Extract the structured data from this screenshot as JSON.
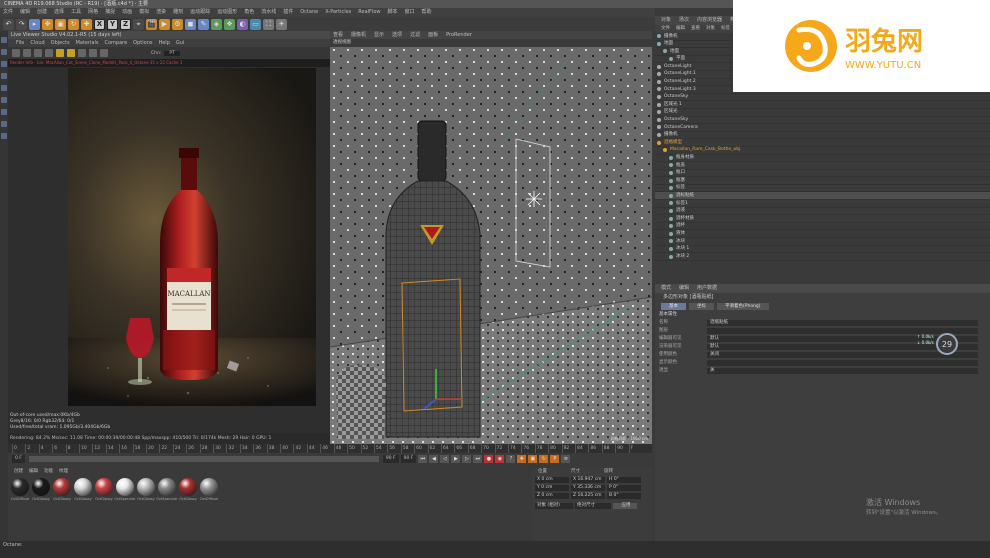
{
  "app": {
    "title": "CINEMA 4D R19.068 Studio (RC - R19) - [酒瓶.c4d *] - 主要",
    "menus": [
      "文件",
      "编辑",
      "创建",
      "选择",
      "工具",
      "网格",
      "捕捉",
      "动画",
      "模拟",
      "渲染",
      "雕刻",
      "运动跟踪",
      "运动图形",
      "角色",
      "流水线",
      "插件",
      "Octane",
      "X-Particles",
      "RealFlow",
      "脚本",
      "窗口",
      "帮助"
    ],
    "status_text": "Octane:"
  },
  "toolbar": {
    "axis_buttons": [
      "X",
      "Y",
      "Z"
    ]
  },
  "live_viewer": {
    "title": "Live Viewer Studio V4.02.1-R5 (15 days left)",
    "menus": [
      "File",
      "Cloud",
      "Objects",
      "Materials",
      "Compare",
      "Options",
      "Help",
      "Gui"
    ],
    "channel_label": "Chn:",
    "channel_value": "PT",
    "path_text": "Render Info - bin: MacAllan_Cut_Scene_Clone_Models_Pack_4_Octane 35 x 22 Cache 1",
    "stats": [
      "Out-of-core used/max:0Kb/4Gb",
      "Grey8/16: 0/0          Rgb32/64: 0/1",
      "Used/free/total vram: 1.095Gb/3.404Gb/6Gb"
    ],
    "status_line": "Rendering: 84.2%   Ms/sec: 11.08   Time: 00:00:39/00:00:48   Spp/maxspp: 410/500   Tri: 0/174k   Mesh: 29   Hair: 0   GPU: 1"
  },
  "viewport": {
    "menus": [
      "查看",
      "摄像机",
      "显示",
      "选项",
      "过滤",
      "面板",
      "ProRender"
    ],
    "label": "透视视图",
    "footer": "网格间距 : 1000 cm"
  },
  "object_manager": {
    "tabs": [
      "对象",
      "场次",
      "内容浏览器",
      "构造"
    ],
    "menus": [
      "文件",
      "编辑",
      "查看",
      "对象",
      "标签",
      "书签"
    ],
    "items": [
      {
        "label": "摄像机",
        "color": "#8aa"
      },
      {
        "label": "地面",
        "color": "#8aa"
      },
      {
        "label": "地面",
        "color": "#8aa"
      },
      {
        "label": "平面",
        "color": "#8aa"
      },
      {
        "label": "OctaneLight",
        "color": "#aaa"
      },
      {
        "label": "OctaneLight.1",
        "color": "#aaa"
      },
      {
        "label": "OctaneLight.2",
        "color": "#aaa"
      },
      {
        "label": "OctaneLight.3",
        "color": "#aaa"
      },
      {
        "label": "OctaneSky",
        "color": "#aaa"
      },
      {
        "label": "区域光 1",
        "color": "#aaa"
      },
      {
        "label": "区域光",
        "color": "#aaa"
      },
      {
        "label": "OctaneSky",
        "color": "#aaa"
      },
      {
        "label": "OctaneCamera",
        "color": "#aaa"
      },
      {
        "label": "摄像机",
        "color": "#aaa"
      },
      {
        "label": "酒瓶模型",
        "color": "#e0a030"
      },
      {
        "label": "Macallan_Rare_Cask_Bottle_obj",
        "color": "#e0a030"
      },
      {
        "label": "瓶身材质",
        "color": "#8aa"
      },
      {
        "label": "瓶盖",
        "color": "#8aa"
      },
      {
        "label": "瓶口",
        "color": "#8aa"
      },
      {
        "label": "瓶塞",
        "color": "#8aa"
      },
      {
        "label": "标签",
        "color": "#8aa"
      },
      {
        "label": "酒标贴纸",
        "color": "#8aa"
      },
      {
        "label": "标签1",
        "color": "#8aa"
      },
      {
        "label": "酒液",
        "color": "#8aa"
      },
      {
        "label": "酒杯材质",
        "color": "#8aa"
      },
      {
        "label": "酒杯",
        "color": "#8aa"
      },
      {
        "label": "液体",
        "color": "#8aa"
      },
      {
        "label": "冰块",
        "color": "#8aa"
      },
      {
        "label": "冰块 1",
        "color": "#8aa"
      },
      {
        "label": "冰块 2",
        "color": "#8aa"
      }
    ]
  },
  "attribute_manager": {
    "tabs": [
      "模式",
      "编辑",
      "用户数据"
    ],
    "title": "多边形对象 [酒瓶贴纸]",
    "subtabs": [
      "基本",
      "坐标",
      "平滑着色(Phong)"
    ],
    "section": "基本属性",
    "rows": [
      {
        "label": "名称",
        "value": "酒瓶贴纸"
      },
      {
        "label": "图层",
        "value": ""
      },
      {
        "label": "编辑器可见",
        "value": "默认"
      },
      {
        "label": "渲染器可见",
        "value": "默认"
      },
      {
        "label": "使用颜色",
        "value": "关闭"
      },
      {
        "label": "显示颜色",
        "value": ""
      },
      {
        "label": "透显",
        "value": "关"
      }
    ],
    "speed_badge": "29",
    "kb_up": "↑ 0.0k/s",
    "kb_down": "↓ 0.0k/s"
  },
  "timeline": {
    "ticks": [
      "0",
      "2",
      "4",
      "6",
      "8",
      "10",
      "12",
      "14",
      "16",
      "18",
      "20",
      "22",
      "24",
      "26",
      "28",
      "30",
      "32",
      "34",
      "36",
      "38",
      "40",
      "42",
      "44",
      "46",
      "48",
      "50",
      "52",
      "54",
      "56",
      "58",
      "60",
      "62",
      "64",
      "66",
      "68",
      "70",
      "72",
      "74",
      "76",
      "78",
      "80",
      "82",
      "84",
      "86",
      "88",
      "90",
      "F"
    ],
    "start": "0 F",
    "end": "90 F",
    "end2": "90 F"
  },
  "materials": {
    "menus": [
      "创建",
      "编辑",
      "功能",
      "纹理"
    ],
    "balls": [
      {
        "name": "OctDiffuse",
        "color": "#2a2a2a"
      },
      {
        "name": "OctGlossy",
        "color": "#1a1a1a"
      },
      {
        "name": "OctGlossy",
        "color": "#b23a3a"
      },
      {
        "name": "OctGlossy",
        "color": "#d8d8d8"
      },
      {
        "name": "OctGlossy",
        "color": "#cc4444"
      },
      {
        "name": "OctSpecular",
        "color": "#e8e8e8"
      },
      {
        "name": "OctGlossy",
        "color": "#bbbbbb"
      },
      {
        "name": "OctSpecular",
        "color": "#8a8a8a"
      },
      {
        "name": "OctGlossy",
        "color": "#a83030"
      },
      {
        "name": "OctDiffuse",
        "color": "#9a9a9a"
      }
    ]
  },
  "coordinates": {
    "headers": [
      "位置",
      "尺寸",
      "旋转"
    ],
    "rows": [
      {
        "a": "X  0 cm",
        "b": "X  16.947 cm",
        "c": "H  0°"
      },
      {
        "a": "Y  0 cm",
        "b": "Y  35.336 cm",
        "c": "P  0°"
      },
      {
        "a": "Z  0 cm",
        "b": "Z  16.225 cm",
        "c": "B  0°"
      }
    ],
    "mode": "对象 (相对)",
    "size_mode": "绝对尺寸",
    "apply": "应用"
  },
  "watermarks": {
    "logo_text": "羽兔网",
    "logo_url": "WWW.YUTU.CN",
    "windows_line1": "激活 Windows",
    "windows_line2": "转到\"设置\"以激活 Windows。"
  }
}
